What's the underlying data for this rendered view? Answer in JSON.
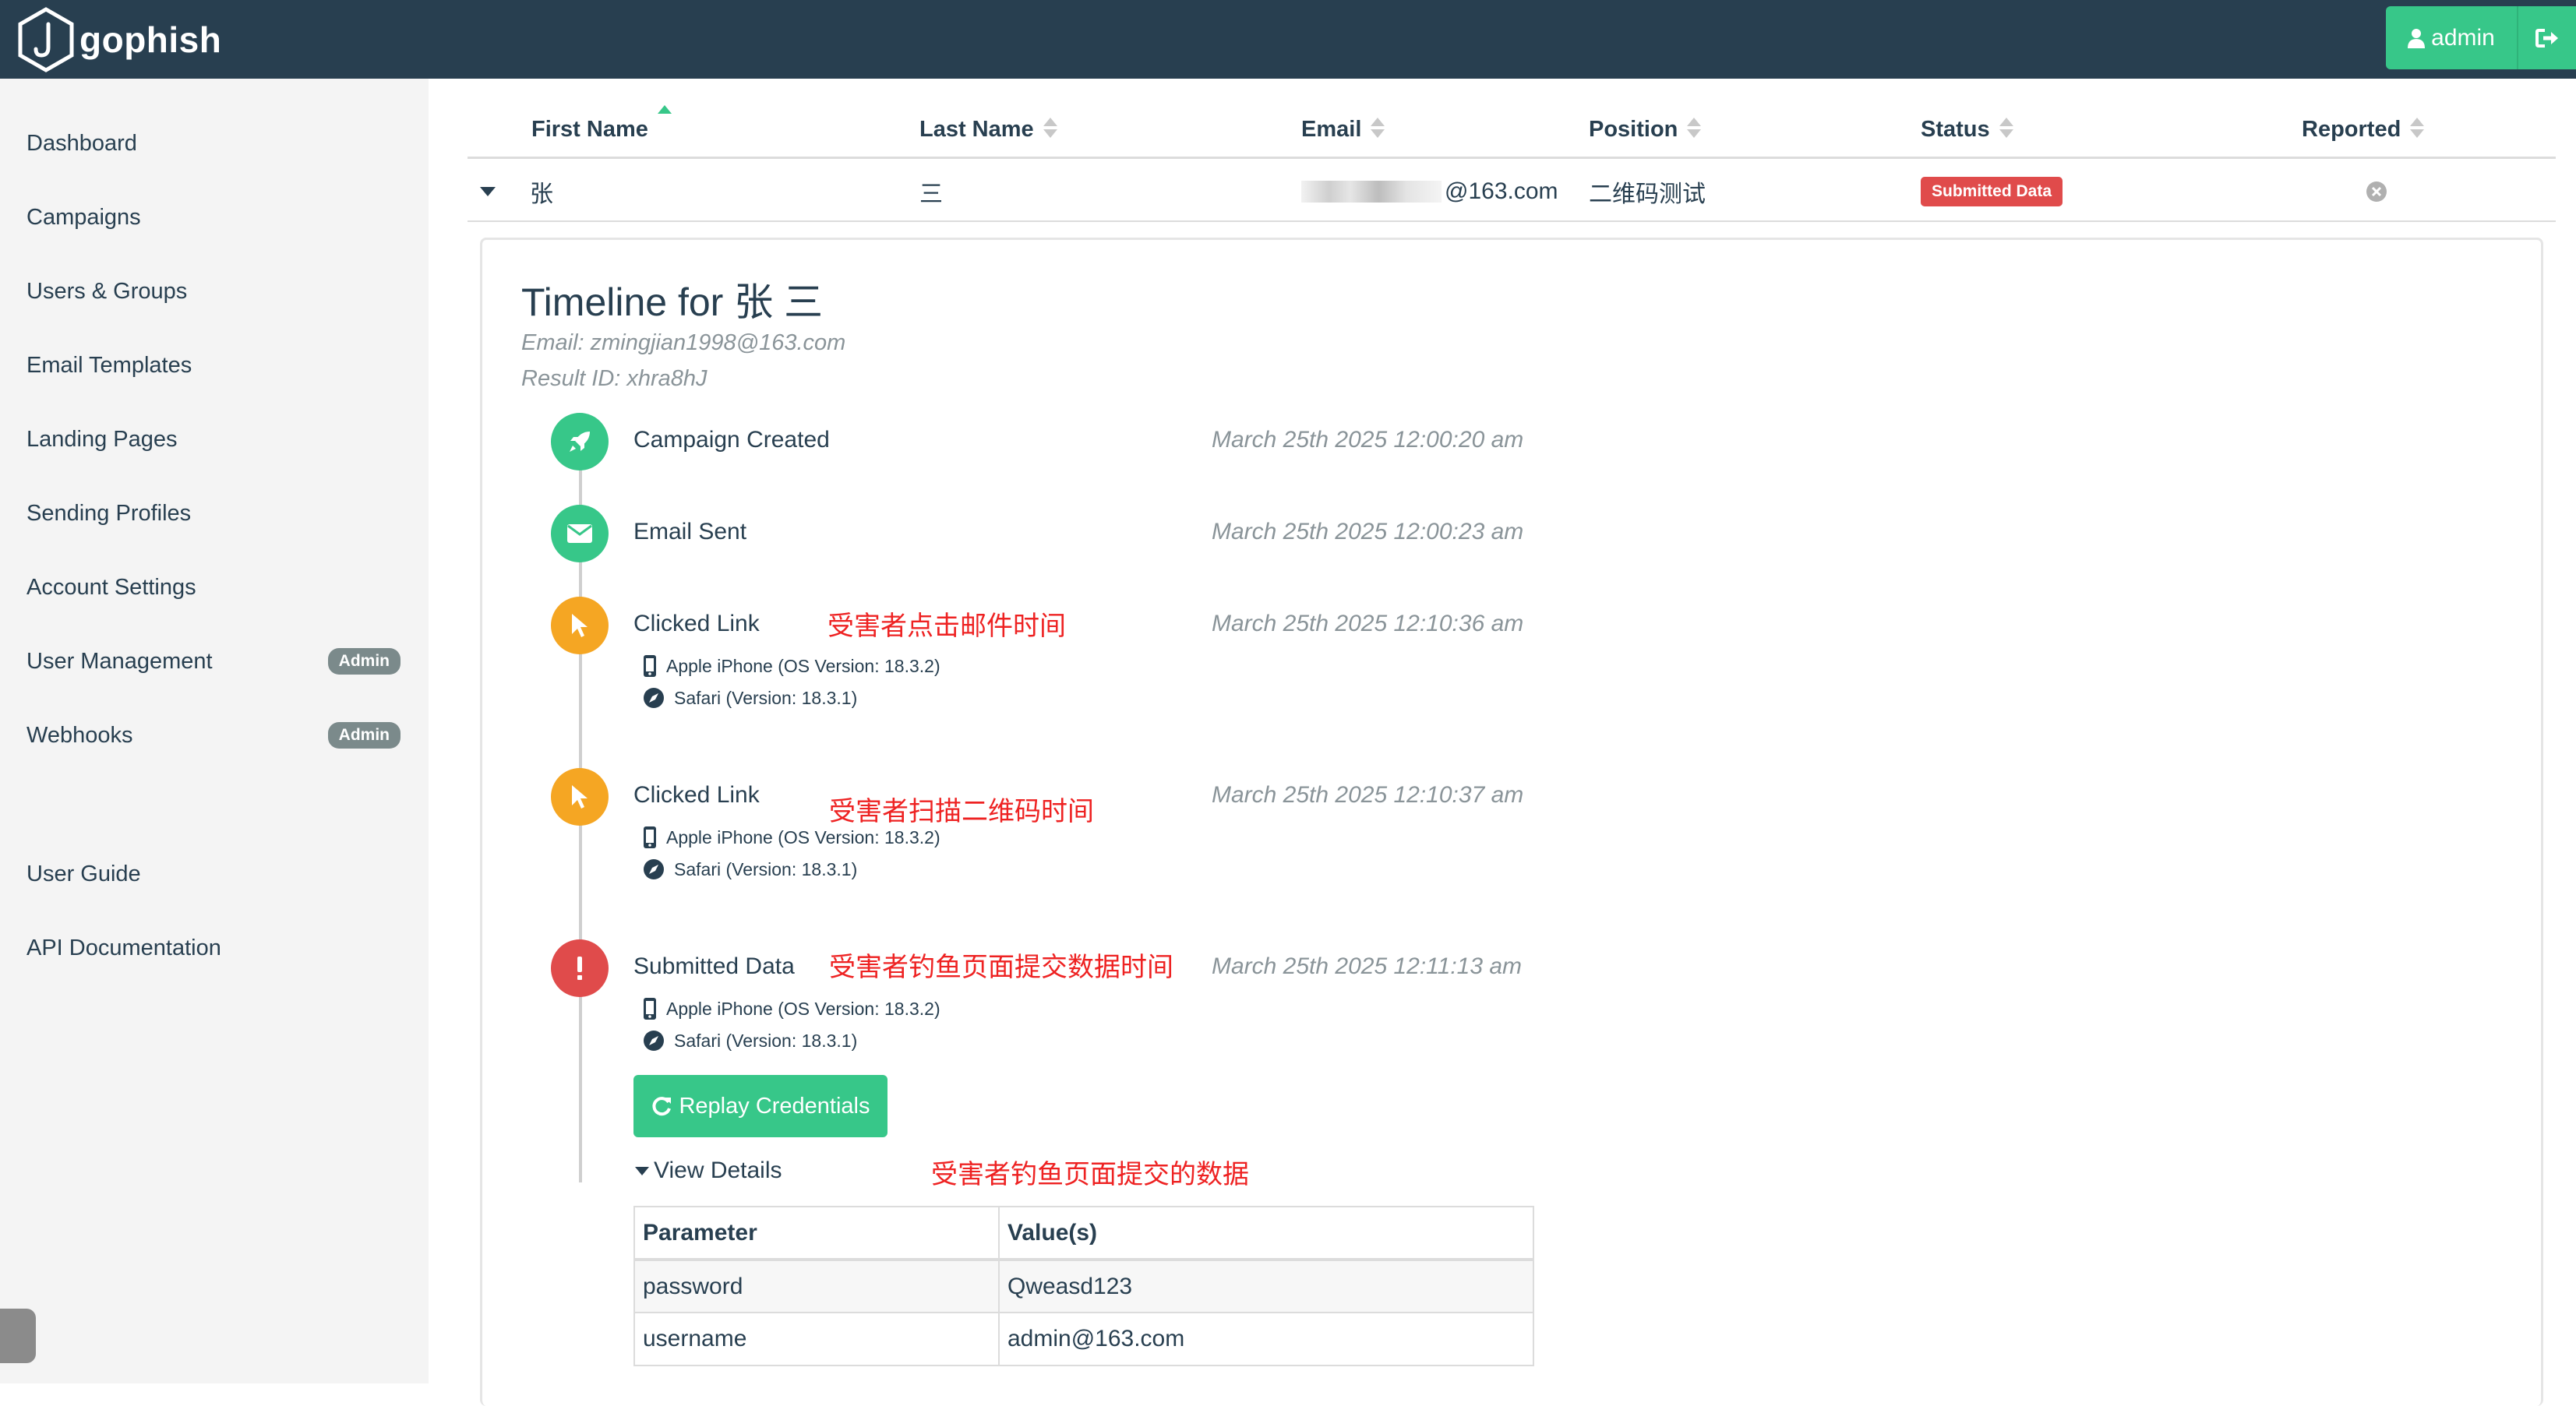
{
  "brand": {
    "name": "gophish"
  },
  "navbar": {
    "user_label": "admin",
    "icons": [
      "user-icon",
      "logout-icon"
    ]
  },
  "sidebar": {
    "items": [
      {
        "label": "Dashboard"
      },
      {
        "label": "Campaigns"
      },
      {
        "label": "Users & Groups"
      },
      {
        "label": "Email Templates"
      },
      {
        "label": "Landing Pages"
      },
      {
        "label": "Sending Profiles"
      },
      {
        "label": "Account Settings"
      },
      {
        "label": "User Management",
        "badge": "Admin"
      },
      {
        "label": "Webhooks",
        "badge": "Admin"
      },
      {
        "label": "User Guide"
      },
      {
        "label": "API Documentation"
      }
    ]
  },
  "results_table": {
    "headers": [
      "First Name",
      "Last Name",
      "Email",
      "Position",
      "Status",
      "Reported"
    ],
    "row": {
      "first_name": "张",
      "last_name": "三",
      "email_suffix": "@163.com",
      "position": "二维码测试",
      "status": "Submitted Data"
    }
  },
  "timeline": {
    "title": "Timeline for 张 三",
    "email": "Email: zmingjian1998@163.com",
    "result_id": "Result ID: xhra8hJ",
    "events": [
      {
        "label": "Campaign Created",
        "time": "March 25th 2025 12:00:20 am",
        "icon": "rocket-icon",
        "color": "#37c789"
      },
      {
        "label": "Email Sent",
        "time": "March 25th 2025 12:00:23 am",
        "icon": "envelope-icon",
        "color": "#37c789"
      },
      {
        "label": "Clicked Link",
        "time": "March 25th 2025 12:10:36 am",
        "icon": "cursor-icon",
        "color": "#f5a623",
        "note": "受害者点击邮件时间",
        "device": "Apple iPhone (OS Version: 18.3.2)",
        "browser": "Safari (Version: 18.3.1)"
      },
      {
        "label": "Clicked Link",
        "time": "March 25th 2025 12:10:37 am",
        "icon": "cursor-icon",
        "color": "#f5a623",
        "note": "受害者扫描二维码时间",
        "device": "Apple iPhone (OS Version: 18.3.2)",
        "browser": "Safari (Version: 18.3.1)"
      },
      {
        "label": "Submitted Data",
        "time": "March 25th 2025 12:11:13 am",
        "icon": "exclamation-icon",
        "color": "#e04b4b",
        "note": "受害者钓鱼页面提交数据时间",
        "device": "Apple iPhone (OS Version: 18.3.2)",
        "browser": "Safari (Version: 18.3.1)"
      }
    ],
    "replay_button": "Replay Credentials",
    "view_details": "View Details",
    "details_note": "受害者钓鱼页面提交的数据",
    "credentials": {
      "headers": [
        "Parameter",
        "Value(s)"
      ],
      "rows": [
        {
          "param": "password",
          "value": "Qweasd123"
        },
        {
          "param": "username",
          "value": "admin@163.com"
        }
      ]
    }
  }
}
